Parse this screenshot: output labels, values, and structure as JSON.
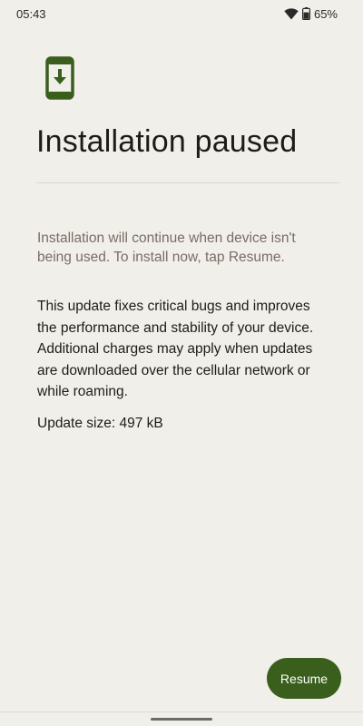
{
  "status_bar": {
    "time": "05:43",
    "battery_percent": "65%",
    "icons": [
      "wifi-icon",
      "battery-icon"
    ]
  },
  "app_icon": "phone-download-icon",
  "title": "Installation paused",
  "subtext": "Installation will continue when device isn't being used. To install now, tap Resume.",
  "description": "This update fixes critical bugs and improves the performance and stability of your device. Additional charges may apply when updates are downloaded over the cellular network or while roaming.",
  "update_size": "Update size: 497 kB",
  "resume_label": "Resume",
  "colors": {
    "accent": "#3a5f1d",
    "background": "#f1efe9",
    "subtext": "#7a6c66"
  }
}
